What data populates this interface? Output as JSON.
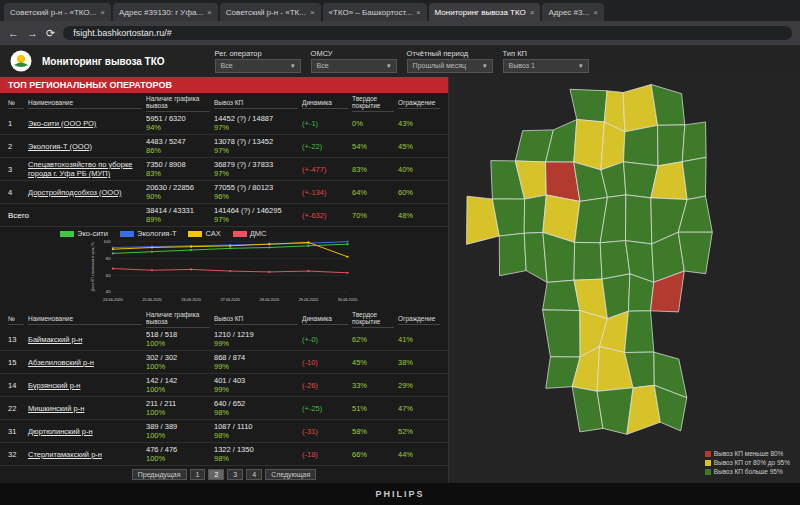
{
  "browser": {
    "tabs": [
      {
        "label": "Советский р-н - «ТКО...",
        "selected": false
      },
      {
        "label": "Адрес #39130: г Уфа...",
        "selected": false
      },
      {
        "label": "Советский р-н - «ТК...",
        "selected": false
      },
      {
        "label": "«ТКО» – Башкортост...",
        "selected": false
      },
      {
        "label": "Мониторинг вывоза ТКО",
        "selected": true
      },
      {
        "label": "Адрес #3...",
        "selected": false
      }
    ],
    "close_glyph": "×",
    "nav": [
      "←",
      "→",
      "⟳"
    ],
    "url": "fsight.bashkortostan.ru/#"
  },
  "header": {
    "title": "Мониторинг вывоза ТКО"
  },
  "filters": [
    {
      "label": "Рег. оператор",
      "value": "Все"
    },
    {
      "label": "ОМСУ",
      "value": "Все"
    },
    {
      "label": "Отчётный период",
      "value": "Прошлый месяц"
    },
    {
      "label": "Тип КП",
      "value": "Вывоз 1"
    }
  ],
  "dropdown_glyph": "▾",
  "top_operators": {
    "title": "ТОП РЕГИОНАЛЬНЫХ ОПЕРАТОРОВ",
    "columns": [
      "№",
      "Наименование",
      "Наличие графика вывоза",
      "Вывоз КП",
      "Динамика",
      "Твердое покрытие",
      "Ограждение"
    ],
    "rows": [
      {
        "num": "1",
        "name": "Эко-сити (ООО РО)",
        "schedule": "5951 / 6320",
        "schedule_pct": "94%",
        "export": "14452 (?) / 14887",
        "export_pct": "97%",
        "dynamics": "(+-1)",
        "dyn_color": "#3fbf3f",
        "surface": "0%",
        "fence": "43%"
      },
      {
        "num": "2",
        "name": "Экология-Т (ООО)",
        "schedule": "4483 / 5247",
        "schedule_pct": "86%",
        "export": "13078 (?) / 13452",
        "export_pct": "97%",
        "dynamics": "(+-22)",
        "dyn_color": "#3fbf3f",
        "surface": "54%",
        "fence": "45%"
      },
      {
        "num": "3",
        "name": "Спецавтохозяйство по уборке города г. Уфа РБ (МУП)",
        "schedule": "7350 / 8908",
        "schedule_pct": "83%",
        "export": "36879 (?) / 37833",
        "export_pct": "97%",
        "dynamics": "(+-477)",
        "dyn_color": "#e04848",
        "surface": "83%",
        "fence": "40%"
      },
      {
        "num": "4",
        "name": "Дорстройподсобхоз (ООО)",
        "schedule": "20630 / 22856",
        "schedule_pct": "90%",
        "export": "77055 (?) / 80123",
        "export_pct": "96%",
        "dynamics": "(+-134)",
        "dyn_color": "#e04848",
        "surface": "64%",
        "fence": "60%"
      }
    ],
    "total": {
      "label": "Всего",
      "schedule": "38414 / 43331",
      "schedule_pct": "89%",
      "export": "141464 (?) / 146295",
      "export_pct": "97%",
      "dynamics": "(+-632)",
      "dyn_color": "#e04848",
      "surface": "70%",
      "fence": "48%"
    }
  },
  "chart": {
    "y_label": "Доля КП с вывозом в срок, %",
    "y_ticks": [
      "100",
      "80",
      "60",
      "40"
    ],
    "y_min": 40,
    "y_max": 100,
    "dates": [
      "24.06.2020",
      "25.06.2020",
      "26.06.2020",
      "27.06.2020",
      "28.06.2020",
      "29.06.2020",
      "30.06.2020"
    ],
    "series": [
      {
        "name": "Эко-сити",
        "color": "#3ec93e",
        "values": [
          86,
          88,
          90,
          92,
          93,
          95,
          97
        ]
      },
      {
        "name": "Экология-Т",
        "color": "#3a6ee8",
        "values": [
          93,
          94,
          95,
          96,
          97,
          98,
          100
        ]
      },
      {
        "name": "САХ",
        "color": "#f2c500",
        "values": [
          91,
          93,
          94,
          95,
          97,
          99,
          82
        ]
      },
      {
        "name": "ДМС",
        "color": "#f05060",
        "values": [
          68,
          66,
          67,
          65,
          64,
          65,
          63
        ]
      }
    ]
  },
  "districts": {
    "columns": [
      "№",
      "Наименование",
      "Наличие графика вывоза",
      "Вывоз КП",
      "Динамика",
      "Твердое покрытие",
      "Ограждение"
    ],
    "rows": [
      {
        "num": "13",
        "name": "Баймакский р-н",
        "schedule": "518 / 518",
        "schedule_pct": "100%",
        "export": "1210 / 1219",
        "export_pct": "99%",
        "dynamics": "(+-0)",
        "dyn_color": "#3fbf3f",
        "surface": "62%",
        "fence": "41%"
      },
      {
        "num": "15",
        "name": "Абзелиловский р-н",
        "schedule": "302 / 302",
        "schedule_pct": "100%",
        "export": "868 / 874",
        "export_pct": "99%",
        "dynamics": "(-10)",
        "dyn_color": "#e04848",
        "surface": "45%",
        "fence": "38%"
      },
      {
        "num": "14",
        "name": "Бурзянский р-н",
        "schedule": "142 / 142",
        "schedule_pct": "100%",
        "export": "401 / 403",
        "export_pct": "99%",
        "dynamics": "(-26)",
        "dyn_color": "#e04848",
        "surface": "33%",
        "fence": "29%"
      },
      {
        "num": "22",
        "name": "Мишкинский р-н",
        "schedule": "211 / 211",
        "schedule_pct": "100%",
        "export": "640 / 652",
        "export_pct": "98%",
        "dynamics": "(+-25)",
        "dyn_color": "#3fbf3f",
        "surface": "51%",
        "fence": "47%"
      },
      {
        "num": "31",
        "name": "Дюртюлинский р-н",
        "schedule": "389 / 389",
        "schedule_pct": "100%",
        "export": "1087 / 1110",
        "export_pct": "98%",
        "dynamics": "(-31)",
        "dyn_color": "#e04848",
        "surface": "58%",
        "fence": "52%"
      },
      {
        "num": "32",
        "name": "Стерлитамакский р-н",
        "schedule": "476 / 476",
        "schedule_pct": "100%",
        "export": "1322 / 1350",
        "export_pct": "98%",
        "dynamics": "(-18)",
        "dyn_color": "#e04848",
        "surface": "66%",
        "fence": "44%"
      }
    ],
    "pagination": [
      {
        "label": "Предыдущая",
        "selected": false
      },
      {
        "label": "1",
        "selected": false
      },
      {
        "label": "2",
        "selected": true
      },
      {
        "label": "3",
        "selected": false
      },
      {
        "label": "4",
        "selected": false
      },
      {
        "label": "Следующая",
        "selected": false
      }
    ]
  },
  "map": {
    "regions": [
      {
        "color": "#3d7a2a"
      },
      {
        "color": "#d8c22a"
      },
      {
        "color": "#d8c22a"
      },
      {
        "color": "#3d7a2a"
      },
      {
        "color": "#3d7a2a"
      },
      {
        "color": "#3d7a2a"
      },
      {
        "color": "#d8c22a"
      },
      {
        "color": "#d8c22a"
      },
      {
        "color": "#3d7a2a"
      },
      {
        "color": "#3d7a2a"
      },
      {
        "color": "#3d7a2a"
      },
      {
        "color": "#3d7a2a"
      },
      {
        "color": "#d8c22a"
      },
      {
        "color": "#b23a2f"
      },
      {
        "color": "#3d7a2a"
      },
      {
        "color": "#3d7a2a"
      },
      {
        "color": "#3d7a2a"
      },
      {
        "color": "#d8c22a"
      },
      {
        "color": "#3d7a2a"
      },
      {
        "color": "#d8c22a"
      },
      {
        "color": "#3d7a2a"
      },
      {
        "color": "#3d7a2a"
      },
      {
        "color": "#d8c22a"
      },
      {
        "color": "#3d7a2a"
      },
      {
        "color": "#3d7a2a"
      },
      {
        "color": "#3d7a2a"
      },
      {
        "color": "#3d7a2a"
      },
      {
        "color": "#3d7a2a"
      },
      {
        "color": "#3d7a2a"
      },
      {
        "color": "#3d7a2a"
      },
      {
        "color": "#3d7a2a"
      },
      {
        "color": "#3d7a2a"
      },
      {
        "color": "#3d7a2a"
      },
      {
        "color": "#3d7a2a"
      },
      {
        "color": "#3d7a2a"
      },
      {
        "color": "#3d7a2a"
      },
      {
        "color": "#3d7a2a"
      },
      {
        "color": "#d8c22a"
      },
      {
        "color": "#3d7a2a"
      },
      {
        "color": "#3d7a2a"
      },
      {
        "color": "#b23a2f"
      },
      {
        "color": "#3d7a2a"
      },
      {
        "color": "#d8c22a"
      },
      {
        "color": "#d8c22a"
      },
      {
        "color": "#3d7a2a"
      },
      {
        "color": "#3d7a2a"
      },
      {
        "color": "#d8c22a"
      },
      {
        "color": "#d8c22a"
      },
      {
        "color": "#3d7a2a"
      },
      {
        "color": "#3d7a2a"
      },
      {
        "color": "#3d7a2a"
      },
      {
        "color": "#3d7a2a"
      },
      {
        "color": "#d8c22a"
      },
      {
        "color": "#3d7a2a"
      }
    ],
    "legend": [
      {
        "label": "Вывоз КП меньше 80%",
        "color": "#b23a2f"
      },
      {
        "label": "Вывоз КП от 80% до 95%",
        "color": "#d8c22a"
      },
      {
        "label": "Вывоз КП больше 95%",
        "color": "#3d7a2a"
      }
    ]
  },
  "monitor": {
    "brand": "PHILIPS"
  }
}
